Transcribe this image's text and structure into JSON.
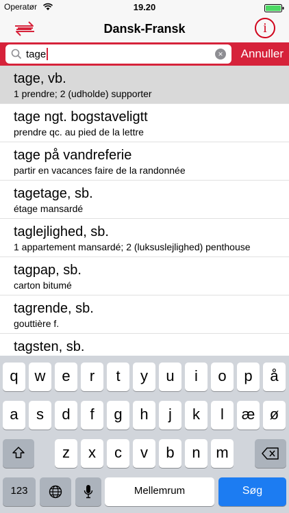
{
  "status_bar": {
    "carrier": "Operatør",
    "time": "19.20"
  },
  "nav": {
    "title": "Dansk-Fransk",
    "info_label": "i"
  },
  "search": {
    "query": "tage",
    "cancel_label": "Annuller"
  },
  "results": [
    {
      "headword": "tage, vb.",
      "translation": "1 prendre; 2 (udholde) supporter",
      "selected": true
    },
    {
      "headword": "tage ngt. bogstaveligtt",
      "translation": "prendre qc. au pied de la lettre"
    },
    {
      "headword": "tage på vandreferie",
      "translation": "partir en vacances faire de la randonnée"
    },
    {
      "headword": "tagetage, sb.",
      "translation": "étage mansardé"
    },
    {
      "headword": "taglejlighed, sb.",
      "translation": "1 appartement mansardé; 2 (luksuslejlighed) penthouse"
    },
    {
      "headword": "tagpap, sb.",
      "translation": "carton bitumé"
    },
    {
      "headword": "tagrende, sb.",
      "translation": "gouttière f."
    },
    {
      "headword": "tagsten, sb.",
      "translation": ""
    }
  ],
  "keyboard": {
    "row1": [
      "q",
      "w",
      "e",
      "r",
      "t",
      "y",
      "u",
      "i",
      "o",
      "p",
      "å"
    ],
    "row2": [
      "a",
      "s",
      "d",
      "f",
      "g",
      "h",
      "j",
      "k",
      "l",
      "æ",
      "ø"
    ],
    "row3": [
      "z",
      "x",
      "c",
      "v",
      "b",
      "n",
      "m"
    ],
    "numbers_label": "123",
    "space_label": "Mellemrum",
    "search_label": "Søg"
  },
  "colors": {
    "accent": "#d6223a",
    "search_key": "#1c7cf2"
  }
}
